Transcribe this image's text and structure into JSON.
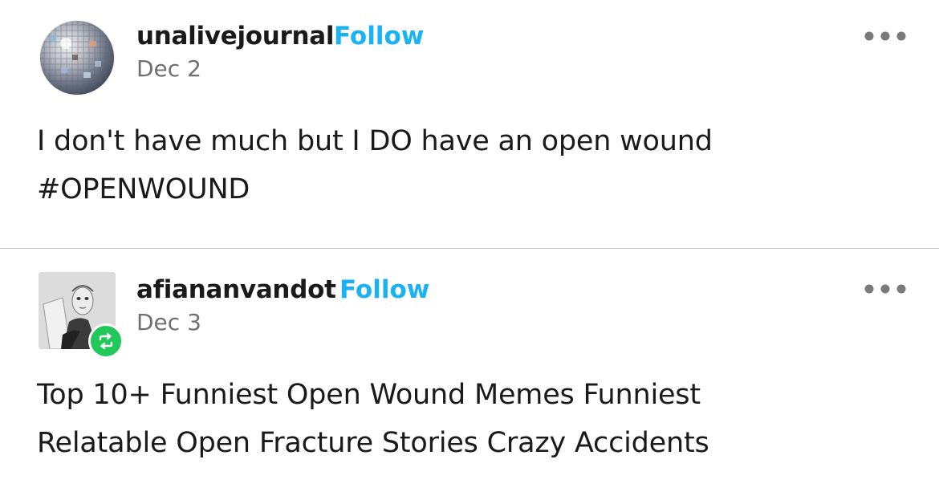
{
  "posts": [
    {
      "username": "unalivejournal",
      "follow_label": "Follow",
      "date": "Dec 2",
      "avatar_icon": "disco-ball-avatar",
      "more_icon": "more-options-icon",
      "body_lines": [
        "I don't have much but I DO have an open wound",
        "#OPENWOUND"
      ]
    },
    {
      "username": "afiananvandot",
      "follow_label": "Follow",
      "date": "Dec 3",
      "avatar_icon": "masked-figure-avatar",
      "badge_icon": "reblog-icon",
      "more_icon": "more-options-icon",
      "body_lines": [
        "Top 10+ Funniest Open Wound Memes Funniest",
        "Relatable Open Fracture Stories Crazy Accidents"
      ]
    }
  ],
  "colors": {
    "follow": "#1ab2f5",
    "username": "#1a1a1a",
    "date": "#707070",
    "divider": "#cfcfcf",
    "reblog_badge": "#21c95a",
    "more_dots": "#7a7a7a"
  }
}
